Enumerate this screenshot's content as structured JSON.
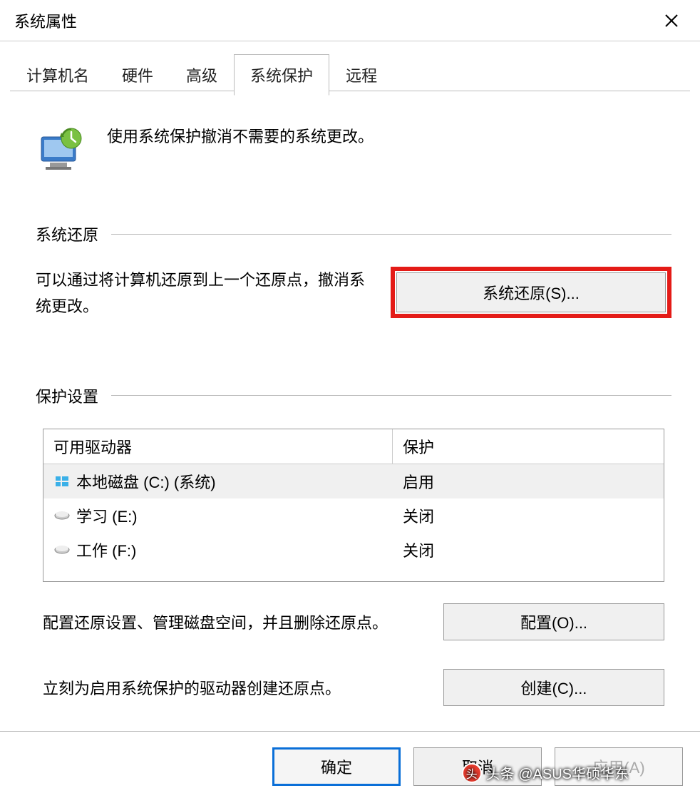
{
  "window": {
    "title": "系统属性",
    "close_icon": "close"
  },
  "tabs": {
    "items": [
      {
        "label": "计算机名"
      },
      {
        "label": "硬件"
      },
      {
        "label": "高级"
      },
      {
        "label": "系统保护"
      },
      {
        "label": "远程"
      }
    ],
    "active_index": 3
  },
  "hero": {
    "text": "使用系统保护撤消不需要的系统更改。"
  },
  "sections": {
    "restore": {
      "title": "系统还原",
      "desc": "可以通过将计算机还原到上一个还原点，撤消系统更改。",
      "button_label": "系统还原(S)..."
    },
    "protection": {
      "title": "保护设置",
      "header_drive": "可用驱动器",
      "header_protection": "保护",
      "drives": [
        {
          "name": "本地磁盘 (C:) (系统)",
          "status": "启用",
          "type": "windows",
          "selected": true
        },
        {
          "name": "学习 (E:)",
          "status": "关闭",
          "type": "hdd",
          "selected": false
        },
        {
          "name": "工作 (F:)",
          "status": "关闭",
          "type": "hdd",
          "selected": false
        }
      ],
      "configure_desc": "配置还原设置、管理磁盘空间，并且删除还原点。",
      "configure_button": "配置(O)...",
      "create_desc": "立刻为启用系统保护的驱动器创建还原点。",
      "create_button": "创建(C)..."
    }
  },
  "footer": {
    "ok": "确定",
    "cancel": "取消",
    "apply": "应用(A)"
  },
  "watermark": {
    "text": "头条 @ASUS华硕华东"
  }
}
